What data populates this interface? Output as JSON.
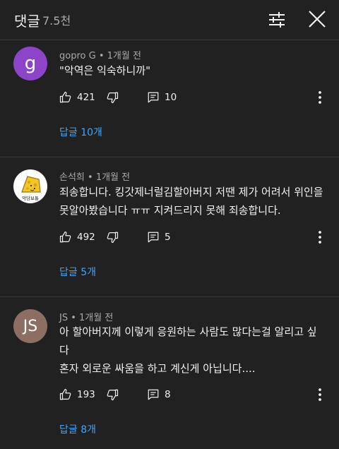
{
  "header": {
    "title": "댓글",
    "count": "7.5천"
  },
  "comments": [
    {
      "author": "gopro G",
      "time": "1개월 전",
      "avatar_letter": "g",
      "avatar_color": "#8e44c9",
      "lines": [
        "\"악역은 익숙하니까\""
      ],
      "likes": "421",
      "reply_count": "10",
      "view_replies": "답글 10개"
    },
    {
      "author": "손석희",
      "time": "1개월 전",
      "avatar_caption": "악당보통",
      "avatar_color": "#ffffff",
      "lines": [
        "죄송합니다. 킹갓제너럴김할아버지 저땐 제가 어려서 위인을",
        "못알아봤습니다 ㅠㅠ 지켜드리지 못해 죄송합니다."
      ],
      "likes": "492",
      "reply_count": "5",
      "view_replies": "답글 5개"
    },
    {
      "author": "JS",
      "time": "1개월 전",
      "avatar_letter": "JS",
      "avatar_color": "#8d6e63",
      "lines": [
        "아 할아버지께 이렇게 응원하는 사람도 많다는걸 알리고 싶",
        "다",
        "혼자 외로운 싸움을 하고 계신게 아닙니다...."
      ],
      "likes": "193",
      "reply_count": "8",
      "view_replies": "답글 8개"
    }
  ],
  "separator": " • ",
  "colors": {
    "background": "#212121",
    "link": "#3ea6ff",
    "secondary_text": "#aaaaaa",
    "notification_dot": "#e62117"
  },
  "icons": {
    "sort": "sort-icon",
    "close": "close-icon",
    "like": "thumbs-up-icon",
    "dislike": "thumbs-down-icon",
    "reply": "reply-icon",
    "more": "more-vert-icon"
  }
}
